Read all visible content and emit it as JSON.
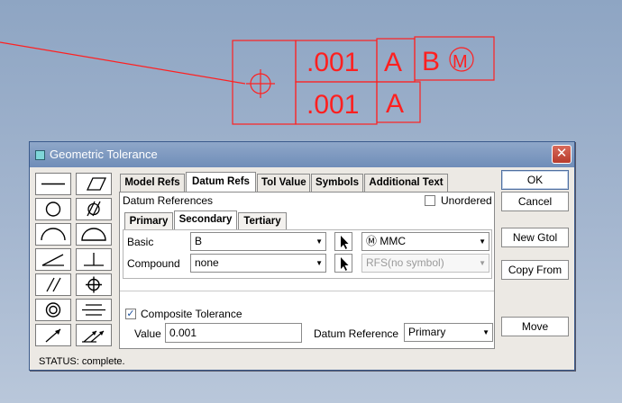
{
  "drawing": {
    "row1": {
      "tolerance": ".001",
      "datum1": "A",
      "datum2": "B",
      "modifier": "M"
    },
    "row2": {
      "tolerance": ".001",
      "datum1": "A"
    },
    "line_color": "#ff2020"
  },
  "dialog": {
    "title": "Geometric Tolerance",
    "close_glyph": "✕",
    "tabs": [
      "Model Refs",
      "Datum Refs",
      "Tol Value",
      "Symbols",
      "Additional Text"
    ],
    "active_tab": "Datum Refs",
    "datum_references_label": "Datum References",
    "unordered_label": "Unordered",
    "subtabs": [
      "Primary",
      "Secondary",
      "Tertiary"
    ],
    "active_subtab": "Secondary",
    "basic": {
      "label": "Basic",
      "value": "B",
      "modifier_icon": "Ⓜ",
      "modifier_value": "MMC"
    },
    "compound": {
      "label": "Compound",
      "value": "none",
      "modifier_value": "RFS(no symbol)"
    },
    "composite": {
      "label": "Composite Tolerance",
      "checked": true
    },
    "value": {
      "label": "Value",
      "value": "0.001"
    },
    "datum_reference": {
      "label": "Datum Reference",
      "value": "Primary"
    },
    "buttons": {
      "ok": "OK",
      "cancel": "Cancel",
      "new_gtol": "New Gtol",
      "copy_from": "Copy From",
      "move": "Move"
    },
    "status": "STATUS: complete."
  },
  "symbols": [
    "straightness-icon",
    "flatness-icon",
    "circularity-icon",
    "cylindricity-icon",
    "profile-line-icon",
    "profile-surface-icon",
    "angularity-icon",
    "perpendicularity-icon",
    "parallelism-icon",
    "position-icon",
    "concentricity-icon",
    "symmetry-icon",
    "circular-runout-icon",
    "total-runout-icon"
  ]
}
